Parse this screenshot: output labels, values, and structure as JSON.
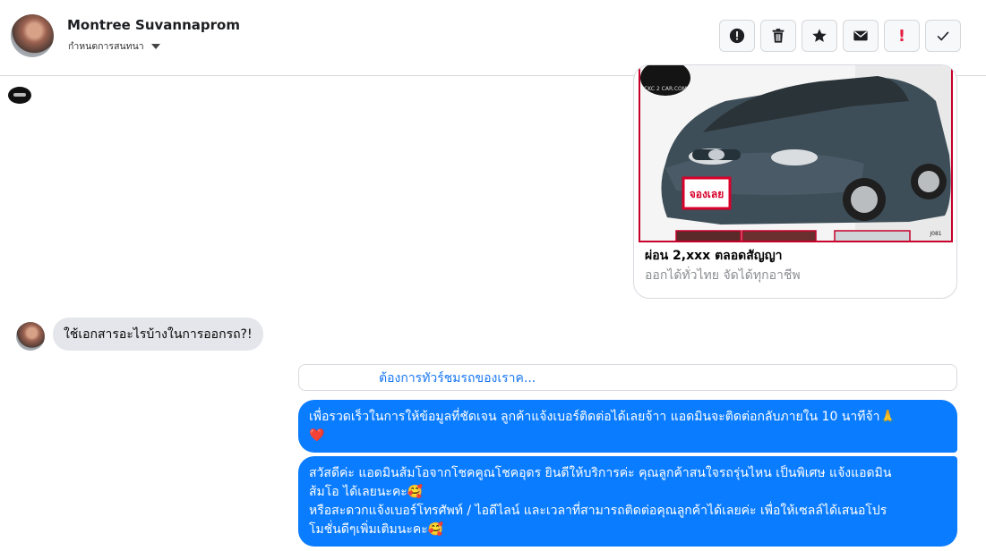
{
  "header": {
    "contact_name": "Montree Suvannaprom",
    "subtitle": "กำหนดการสนทนา",
    "actions": [
      {
        "name": "report-spam-button",
        "icon": "alert-circle-icon"
      },
      {
        "name": "delete-button",
        "icon": "trash-icon"
      },
      {
        "name": "star-button",
        "icon": "star-icon"
      },
      {
        "name": "mark-unread-button",
        "icon": "envelope-icon"
      },
      {
        "name": "follow-up-button",
        "icon": "exclamation-icon",
        "glyph": "!",
        "color": "#e41e3f"
      },
      {
        "name": "done-button",
        "icon": "check-icon"
      }
    ]
  },
  "card": {
    "image_alt": "car-photo",
    "title": "ผ่อน 2,xxx ตลอดสัญญา",
    "subtitle": "ออกได้ทั่วไทย จัดได้ทุกอาชีพ",
    "watermark": "CKC 2 CAR.COM",
    "plate_text": "จองเลย",
    "corner_code": "J081"
  },
  "incoming_message": "ใช้เอกสารอะไรบ้างในการออกรถ?!",
  "link_preview": {
    "text": "ต้องการทัวร์ชมรถของเราค..."
  },
  "outgoing_messages": {
    "msg1_line1": "เพื่อรวดเร็วในการให้ข้อมูลที่ชัดเจน ลูกค้าแจ้งเบอร์ติดต่อได้เลยจ้าา แอดมินจะติดต่อกลับภายใน 10 นาทีจ้า🙏",
    "msg1_line2": "❤️",
    "msg2_line1": "สวัสดีค่ะ แอดมินส้มโอจากโชคคูณโชคอุดร ยินดีให้บริการค่ะ   คุณลูกค้าสนใจรถรุ่นไหน เป็นพิเศษ แจ้งแอดมิน",
    "msg2_line2": "ส้มโอ ได้เลยนะคะ🥰",
    "msg2_line3": "หรือสะดวกแจ้งเบอร์โทรศัพท์ / ไอดีไลน์ และเวลาที่สามารถติดต่อคุณลูกค้าได้เลยค่ะ เพื่อให้เซลล์ได้เสนอโปร",
    "msg2_line4": "โมชั่นดีๆเพิ่มเติมนะคะ🥰"
  },
  "colors": {
    "outgoing_bubble": "#0a7cff",
    "incoming_bubble": "#e4e6eb",
    "link": "#1877f2"
  }
}
